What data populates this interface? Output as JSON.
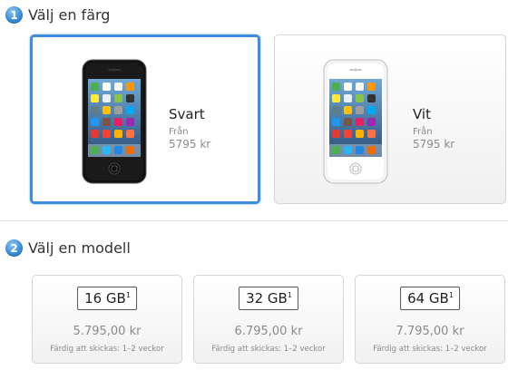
{
  "step1": {
    "number": "1",
    "title": "Välj en färg"
  },
  "colors": [
    {
      "name": "Svart",
      "from_label": "Från",
      "price": "5795 kr",
      "selected": true,
      "icon": "iphone-black-image"
    },
    {
      "name": "Vit",
      "from_label": "Från",
      "price": "5795 kr",
      "selected": false,
      "icon": "iphone-white-image"
    }
  ],
  "step2": {
    "number": "2",
    "title": "Välj en modell"
  },
  "models": [
    {
      "capacity": "16 GB",
      "footnote": "1",
      "price": "5.795,00 kr",
      "shipping": "Färdig att skickas: 1–2 veckor"
    },
    {
      "capacity": "32 GB",
      "footnote": "1",
      "price": "6.795,00 kr",
      "shipping": "Färdig att skickas: 1–2 veckor"
    },
    {
      "capacity": "64 GB",
      "footnote": "1",
      "price": "7.795,00 kr",
      "shipping": "Färdig att skickas: 1–2 veckor"
    }
  ],
  "colors_theme": {
    "accent": "#3d8ee0",
    "muted_text": "#8a8a8a"
  }
}
